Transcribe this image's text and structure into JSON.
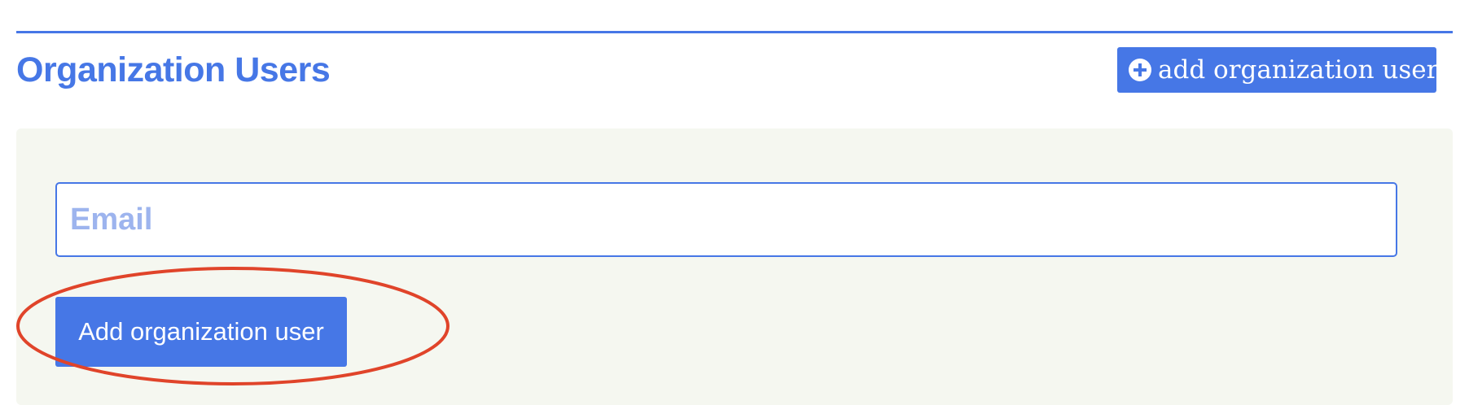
{
  "page": {
    "title": "Organization Users"
  },
  "header": {
    "add_button_label": "add organization user",
    "add_button_icon": "plus-circle-icon"
  },
  "form": {
    "email_placeholder": "Email",
    "email_value": "",
    "submit_label": "Add organization user"
  },
  "colors": {
    "accent": "#4677e6",
    "panel_background": "#f5f7f0",
    "placeholder": "#9db4ee",
    "annotation": "#e0442a"
  }
}
